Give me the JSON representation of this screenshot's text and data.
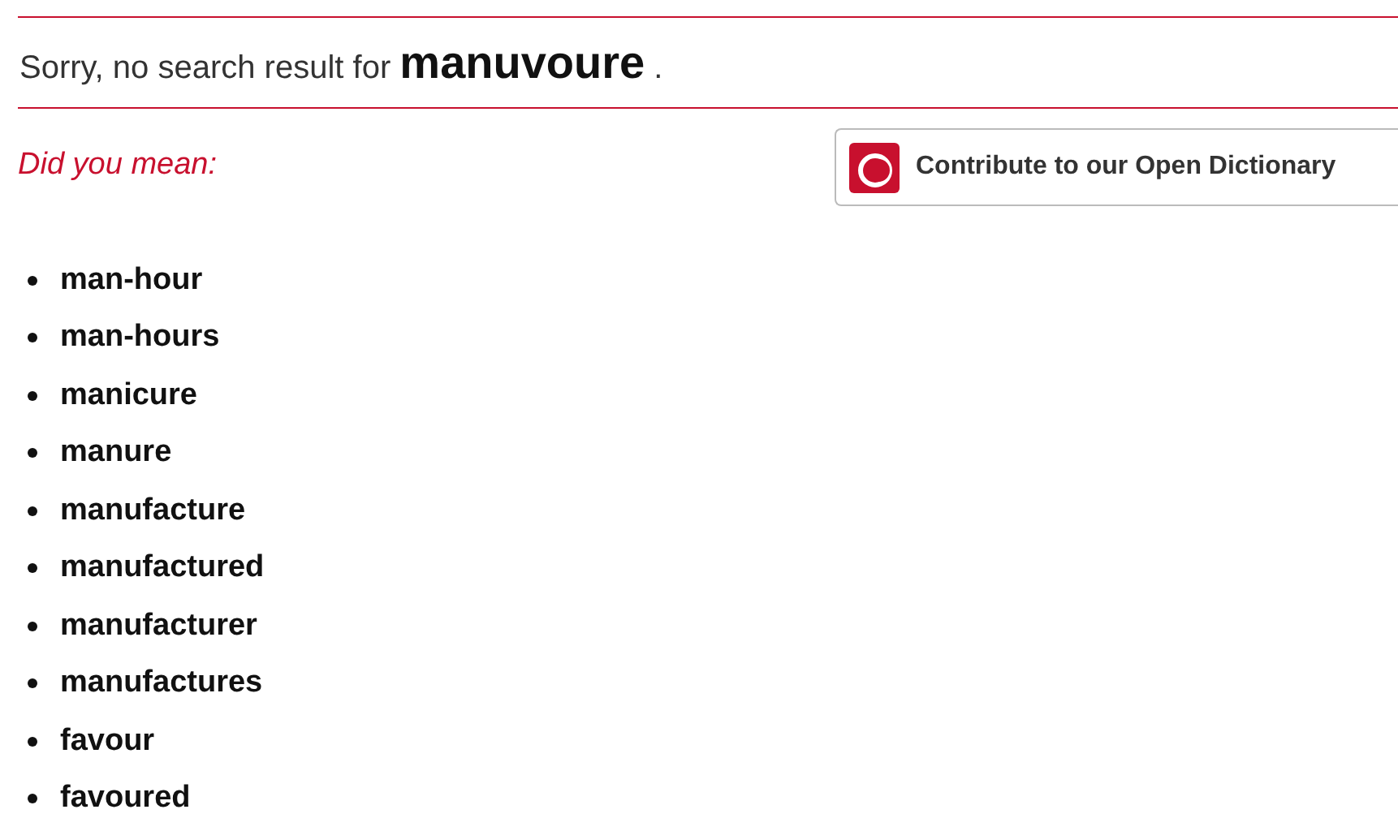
{
  "message": "Sorry, no search result for **manuvoure** .",
  "did_you_mean": "Did you mean:",
  "contribute_button": "Contribute to our Open Dictionary",
  "suggestions": [
    "man-hour",
    "man-hours",
    "manicure",
    "manure",
    "manufacture",
    "manufactured",
    "manufacturer",
    "manufactures",
    "favour",
    "favoured"
  ]
}
